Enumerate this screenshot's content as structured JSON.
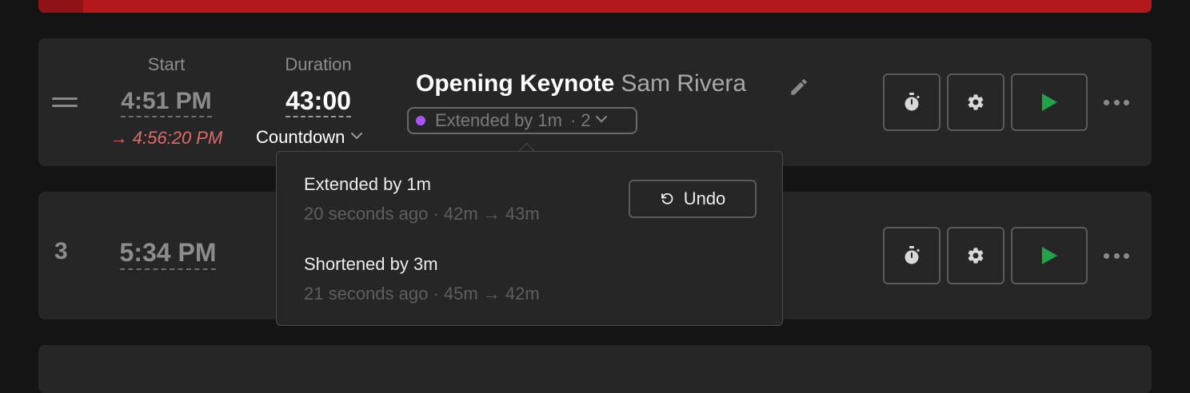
{
  "progress": {
    "fill_fraction": 0.04,
    "color": "#b3191c"
  },
  "rows": [
    {
      "start_label": "Start",
      "duration_label": "Duration",
      "start_time": "4:51 PM",
      "projected_start": "→ 4:56:20 PM",
      "duration": "43:00",
      "timer_type": "Countdown",
      "title": "Opening Keynote",
      "speaker": "Sam Rivera",
      "changes": {
        "label": "Extended by 1m",
        "separator": "·",
        "count": "2",
        "dot_color": "#a855f7"
      }
    },
    {
      "index": "3",
      "start_time": "5:34 PM"
    }
  ],
  "changes_popover": {
    "entries": [
      {
        "title": "Extended by 1m",
        "meta": "20 seconds ago · 42m → 43m"
      },
      {
        "title": "Shortened by 3m",
        "meta": "21 seconds ago · 45m → 42m"
      }
    ],
    "undo_label": "Undo"
  },
  "icons": {
    "drag": "drag-handle-icon",
    "edit": "pencil-icon",
    "timer": "stopwatch-icon",
    "settings": "gear-icon",
    "start": "play-icon",
    "more": "more-horizontal-icon",
    "undo": "undo-icon"
  },
  "colors": {
    "play": "#22a34a",
    "projected": "#e06a6a",
    "accent_bar": "#b3191c"
  }
}
